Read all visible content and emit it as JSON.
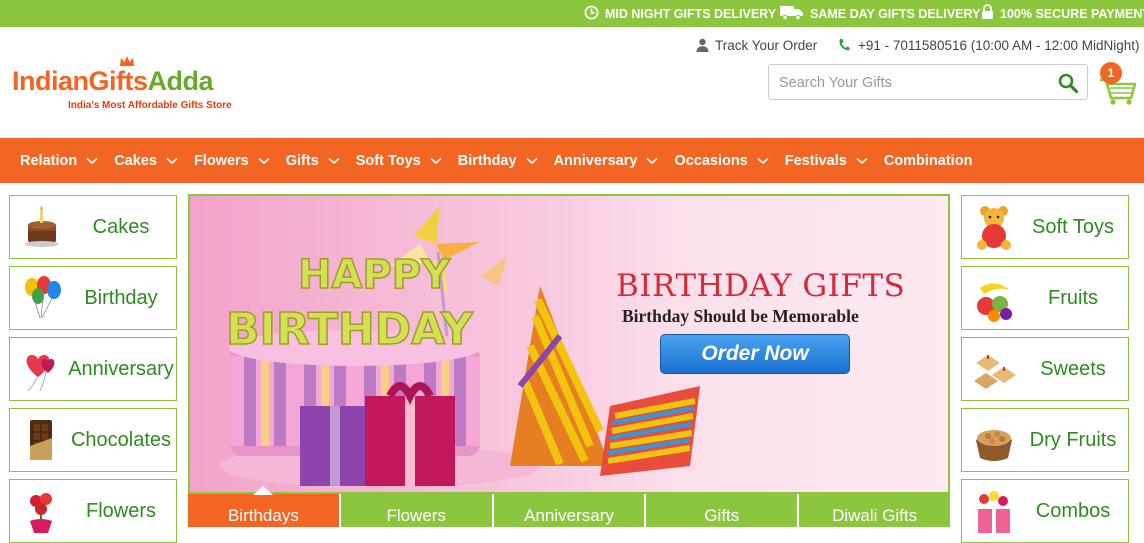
{
  "topbar": {
    "items": [
      {
        "label": "MID NIGHT GIFTS DELIVERY",
        "icon": "clock-icon"
      },
      {
        "label": "SAME DAY GIFTS DELIVERY",
        "icon": "truck-icon"
      },
      {
        "label": "100% SECURE PAYMENT",
        "icon": "lock-icon"
      }
    ]
  },
  "header": {
    "logo": {
      "part1": "Indian",
      "part2": "Gifts",
      "part3": "Adda",
      "tagline": "India's Most Affordable Gifts Store"
    },
    "track_label": "Track Your Order",
    "phone": "+91 - 7011580516 (10:00 AM - 12:00 MidNight)",
    "search_placeholder": "Search Your Gifts",
    "cart_count": "1"
  },
  "nav": [
    {
      "label": "Relation",
      "dropdown": true
    },
    {
      "label": "Cakes",
      "dropdown": true
    },
    {
      "label": "Flowers",
      "dropdown": true
    },
    {
      "label": "Gifts",
      "dropdown": true
    },
    {
      "label": "Soft Toys",
      "dropdown": true
    },
    {
      "label": "Birthday",
      "dropdown": true
    },
    {
      "label": "Anniversary",
      "dropdown": true
    },
    {
      "label": "Occasions",
      "dropdown": true
    },
    {
      "label": "Festivals",
      "dropdown": true
    },
    {
      "label": "Combination",
      "dropdown": false
    }
  ],
  "left_categories": [
    "Cakes",
    "Birthday",
    "Anniversary",
    "Chocolates",
    "Flowers"
  ],
  "right_categories": [
    "Soft Toys",
    "Fruits",
    "Sweets",
    "Dry Fruits",
    "Combos"
  ],
  "banner": {
    "title": "BIRTHDAY GIFTS",
    "subtitle": "Birthday Should be Memorable",
    "cta": "Order Now",
    "cake_text_1": "HAPPY",
    "cake_text_2": "BIRTHDAY"
  },
  "banner_tabs": [
    "Birthdays",
    "Flowers",
    "Anniversary",
    "Gifts",
    "Diwali Gifts"
  ],
  "colors": {
    "green": "#8cc63f",
    "orange": "#f26522",
    "text_green": "#2e8b1f"
  }
}
